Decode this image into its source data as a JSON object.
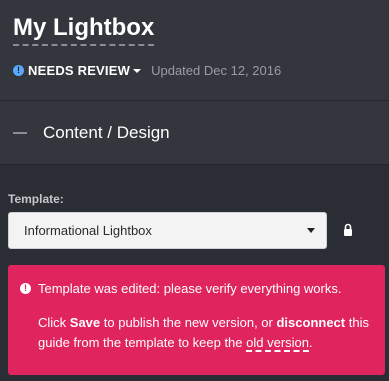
{
  "header": {
    "title": "My Lightbox",
    "status": {
      "icon": "info-icon",
      "label": "NEEDS REVIEW",
      "icon_color": "#5aa8ff"
    },
    "updated": "Updated Dec 12, 2016"
  },
  "section": {
    "icon": "dash-icon",
    "label": "Content / Design"
  },
  "template": {
    "label": "Template:",
    "selected": "Informational Lightbox",
    "lock_icon": "lock-icon"
  },
  "alert": {
    "color": "#e0245e",
    "title": "Template was edited: please verify everything works.",
    "body_click": "Click ",
    "save_label": "Save",
    "body_publish": " to publish the new version, or ",
    "disconnect_label": "disconnect",
    "body_guide": " this guide from the template to keep the ",
    "old_version_label": "old version",
    "body_end": "."
  }
}
